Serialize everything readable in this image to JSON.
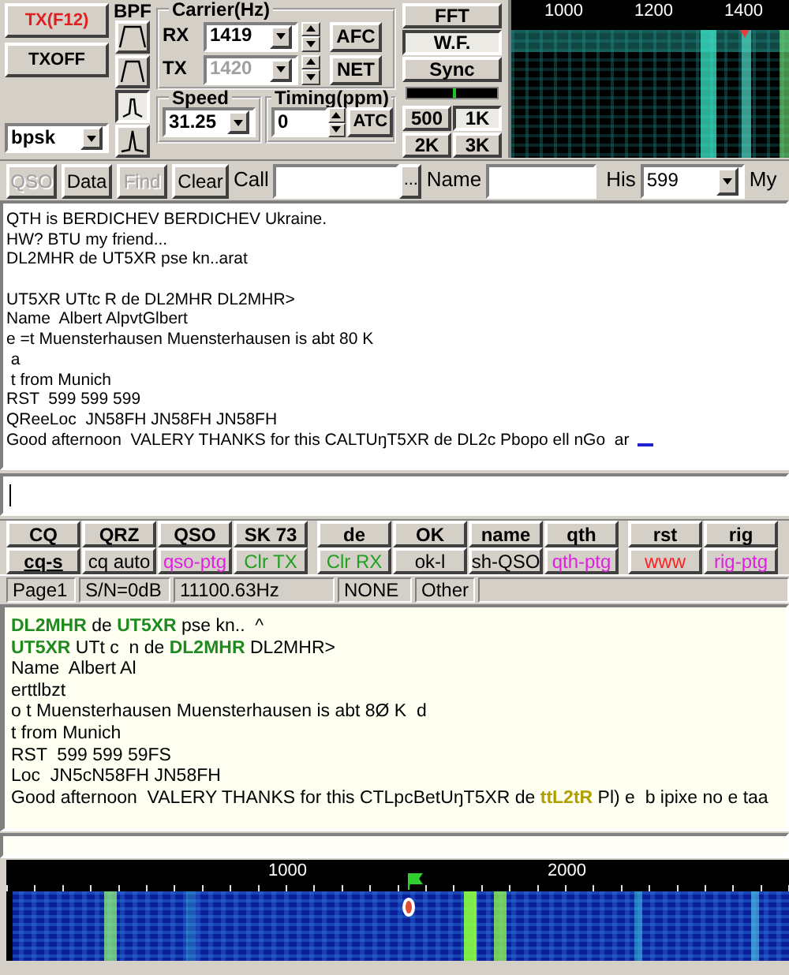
{
  "transmit": {
    "tx_button": "TX(F12)",
    "txoff_button": "TXOFF",
    "mode": "bpsk"
  },
  "bpf": {
    "label": "BPF",
    "filters": [
      {
        "kind": "wide",
        "selected": false
      },
      {
        "kind": "medium",
        "selected": false
      },
      {
        "kind": "narrow",
        "selected": true
      },
      {
        "kind": "sharp",
        "selected": false
      }
    ]
  },
  "carrier": {
    "label": "Carrier(Hz)",
    "rx": {
      "label": "RX",
      "value": "1419",
      "disabled": false
    },
    "tx": {
      "label": "TX",
      "value": "1420",
      "disabled": true
    },
    "afc_button": "AFC",
    "net_button": "NET"
  },
  "speed": {
    "label": "Speed",
    "value": "31.25"
  },
  "timing": {
    "label": "Timing(ppm)",
    "value": "0",
    "atc_button": "ATC"
  },
  "display_buttons": [
    {
      "label": "FFT",
      "selected": false
    },
    {
      "label": "W.F.",
      "selected": true
    },
    {
      "label": "Sync",
      "selected": false
    }
  ],
  "tuning_meter": {
    "level": 0.5
  },
  "span_buttons": [
    {
      "label": "500",
      "selected": false
    },
    {
      "label": "1K",
      "selected": true
    },
    {
      "label": "2K",
      "selected": false
    },
    {
      "label": "3K",
      "selected": false
    }
  ],
  "top_scale": [
    "1000",
    "1200",
    "1400"
  ],
  "toolbar": {
    "buttons": [
      {
        "label": "QSO",
        "disabled": true
      },
      {
        "label": "Data",
        "disabled": false
      },
      {
        "label": "Find",
        "disabled": true
      },
      {
        "label": "Clear",
        "disabled": false
      }
    ],
    "call_label": "Call",
    "browse_button": "...",
    "name_label": "Name",
    "his_label": "His",
    "his_value": "599",
    "my_label": "My"
  },
  "upper_text": {
    "lines": [
      {
        "kind": "text",
        "text": "QTH is BERDICHEV BERDICHEV Ukraine."
      },
      {
        "kind": "text",
        "text": "HW? BTU my friend..."
      },
      {
        "kind": "text",
        "text": "DL2MHR de UT5XR pse kn..arat"
      },
      {
        "kind": "blank"
      },
      {
        "kind": "text",
        "text": "UT5XR UTtc R de DL2MHR DL2MHR>"
      },
      {
        "kind": "text",
        "text": "Name  Albert AlpvtGlbert"
      },
      {
        "kind": "text",
        "text": "e =t Muensterhausen Muensterhausen is abt 80 K"
      },
      {
        "kind": "text",
        "text": " a"
      },
      {
        "kind": "text",
        "text": " t from Munich"
      },
      {
        "kind": "text",
        "text": "RST  599 599 599"
      },
      {
        "kind": "text",
        "text": "QReeLoc  JN58FH JN58FH JN58FH"
      },
      {
        "kind": "text",
        "text": "Good afternoon  VALERY THANKS for this CALTUŋT5XR de DL2c Pbopo ell nGo  ar"
      }
    ],
    "cursor": true
  },
  "macros": [
    [
      {
        "label": "CQ",
        "color": "#000000",
        "emphasized": false
      },
      {
        "label": "QRZ",
        "color": "#000000",
        "emphasized": false
      },
      {
        "label": "QSO",
        "color": "#000000",
        "emphasized": false
      },
      {
        "label": "SK 73",
        "color": "#000000",
        "emphasized": false
      },
      {
        "label": "de",
        "color": "#000000",
        "emphasized": false
      },
      {
        "label": "OK",
        "color": "#000000",
        "emphasized": false
      },
      {
        "label": "name",
        "color": "#000000",
        "emphasized": false
      },
      {
        "label": "qth",
        "color": "#000000",
        "emphasized": false
      },
      {
        "label": "rst",
        "color": "#000000",
        "emphasized": false
      },
      {
        "label": "rig",
        "color": "#000000",
        "emphasized": false
      }
    ],
    [
      {
        "label": "cq-s",
        "color": "#000000",
        "emphasized": true
      },
      {
        "label": "cq auto",
        "color": "#000000",
        "emphasized": false
      },
      {
        "label": "qso-ptg",
        "color": "#e020e0",
        "emphasized": false
      },
      {
        "label": "Clr TX",
        "color": "#20a020",
        "emphasized": false
      },
      {
        "label": "Clr RX",
        "color": "#20a020",
        "emphasized": false
      },
      {
        "label": "ok-l",
        "color": "#000000",
        "emphasized": false
      },
      {
        "label": "sh-QSO",
        "color": "#000000",
        "emphasized": false
      },
      {
        "label": "qth-ptg",
        "color": "#e020e0",
        "emphasized": false
      },
      {
        "label": "www",
        "color": "#ff2020",
        "emphasized": false
      },
      {
        "label": "rig-ptg",
        "color": "#e020e0",
        "emphasized": false
      }
    ]
  ],
  "status_bar": [
    "Page1",
    "S/N=0dB",
    "11100.63Hz",
    "NONE",
    "Other"
  ],
  "lower_text": {
    "lines": [
      {
        "segments": [
          {
            "kind": "call",
            "text": "DL2MHR"
          },
          {
            "kind": "plain",
            "text": " de "
          },
          {
            "kind": "call",
            "text": "UT5XR"
          },
          {
            "kind": "plain",
            "text": " pse kn..  ^"
          }
        ]
      },
      {
        "segments": [
          {
            "kind": "call",
            "text": "UT5XR"
          },
          {
            "kind": "plain",
            "text": " UTt c  n de "
          },
          {
            "kind": "call",
            "text": "DL2MHR"
          },
          {
            "kind": "plain",
            "text": " DL2MHR>"
          }
        ]
      },
      {
        "segments": [
          {
            "kind": "plain",
            "text": "Name  Albert Al"
          }
        ]
      },
      {
        "segments": [
          {
            "kind": "plain",
            "text": "erttlbzt"
          }
        ]
      },
      {
        "segments": [
          {
            "kind": "plain",
            "text": "o t Muensterhausen Muensterhausen is abt 8Ø K  d"
          }
        ]
      },
      {
        "segments": [
          {
            "kind": "plain",
            "text": "t from Munich"
          }
        ]
      },
      {
        "segments": [
          {
            "kind": "plain",
            "text": "RST  599 599 59FS"
          }
        ]
      },
      {
        "segments": [
          {
            "kind": "plain",
            "text": "Loc  JN5cN58FH JN58FH"
          }
        ]
      },
      {
        "segments": [
          {
            "kind": "plain",
            "text": "Good afternoon  VALERY THANKS for this CTLpcBetUŋT5XR de "
          },
          {
            "kind": "highlight",
            "text": "ttL2tR"
          },
          {
            "kind": "plain",
            "text": " Pl) e  b ipixe no e taa"
          }
        ]
      }
    ]
  },
  "bottom_scale": [
    "1000",
    "2000"
  ]
}
